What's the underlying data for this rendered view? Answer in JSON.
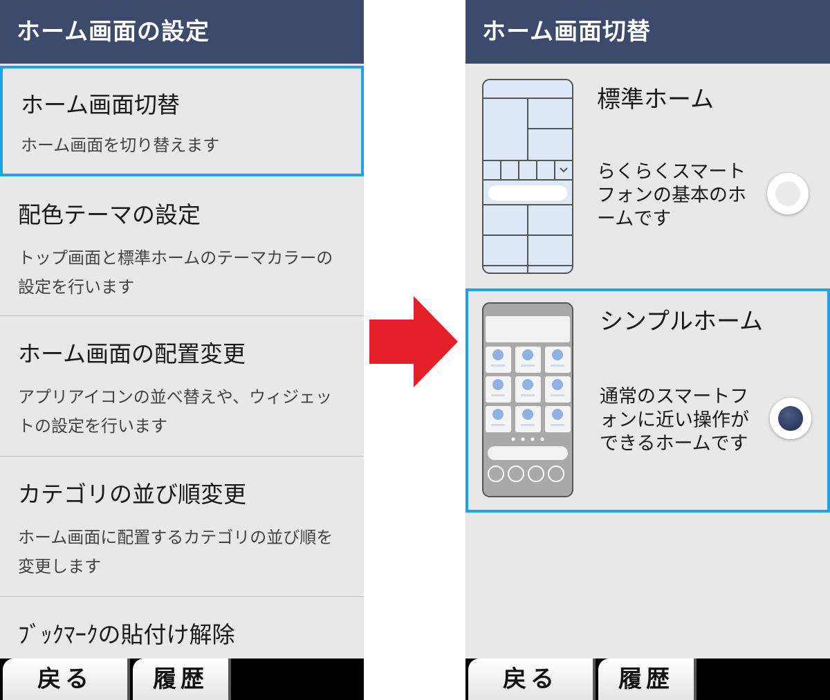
{
  "left_screen": {
    "header_title": "ホーム画面の設定",
    "items": [
      {
        "title": "ホーム画面切替",
        "description": "ホーム画面を切り替えます"
      },
      {
        "title": "配色テーマの設定",
        "description": "トップ画面と標準ホームのテーマカラーの設定を行います"
      },
      {
        "title": "ホーム画面の配置変更",
        "description": "アプリアイコンの並べ替えや、ウィジェットの設定を行います"
      },
      {
        "title": "カテゴリの並び順変更",
        "description": "ホーム画面に配置するカテゴリの並び順を変更します"
      },
      {
        "title": "ﾌﾞｯｸﾏｰｸの貼付け解除"
      }
    ],
    "softkeys": {
      "back": "戻る",
      "history": "履歴"
    }
  },
  "right_screen": {
    "header_title": "ホーム画面切替",
    "options": [
      {
        "title": "標準ホーム",
        "description": "らくらくスマートフォンの基本のホームです",
        "selected": false
      },
      {
        "title": "シンプルホーム",
        "description": "通常のスマートフォンに近い操作ができるホームです",
        "selected": true
      }
    ],
    "softkeys": {
      "back": "戻る",
      "history": "履歴"
    }
  },
  "colors": {
    "header_bg": "#3c4a6c",
    "highlight_border": "#1ea2e6",
    "arrow": "#e5202a",
    "radio_selected": "#2d3d63"
  },
  "icons": [
    "right-arrow-icon",
    "radio-unselected-icon",
    "radio-selected-icon"
  ]
}
